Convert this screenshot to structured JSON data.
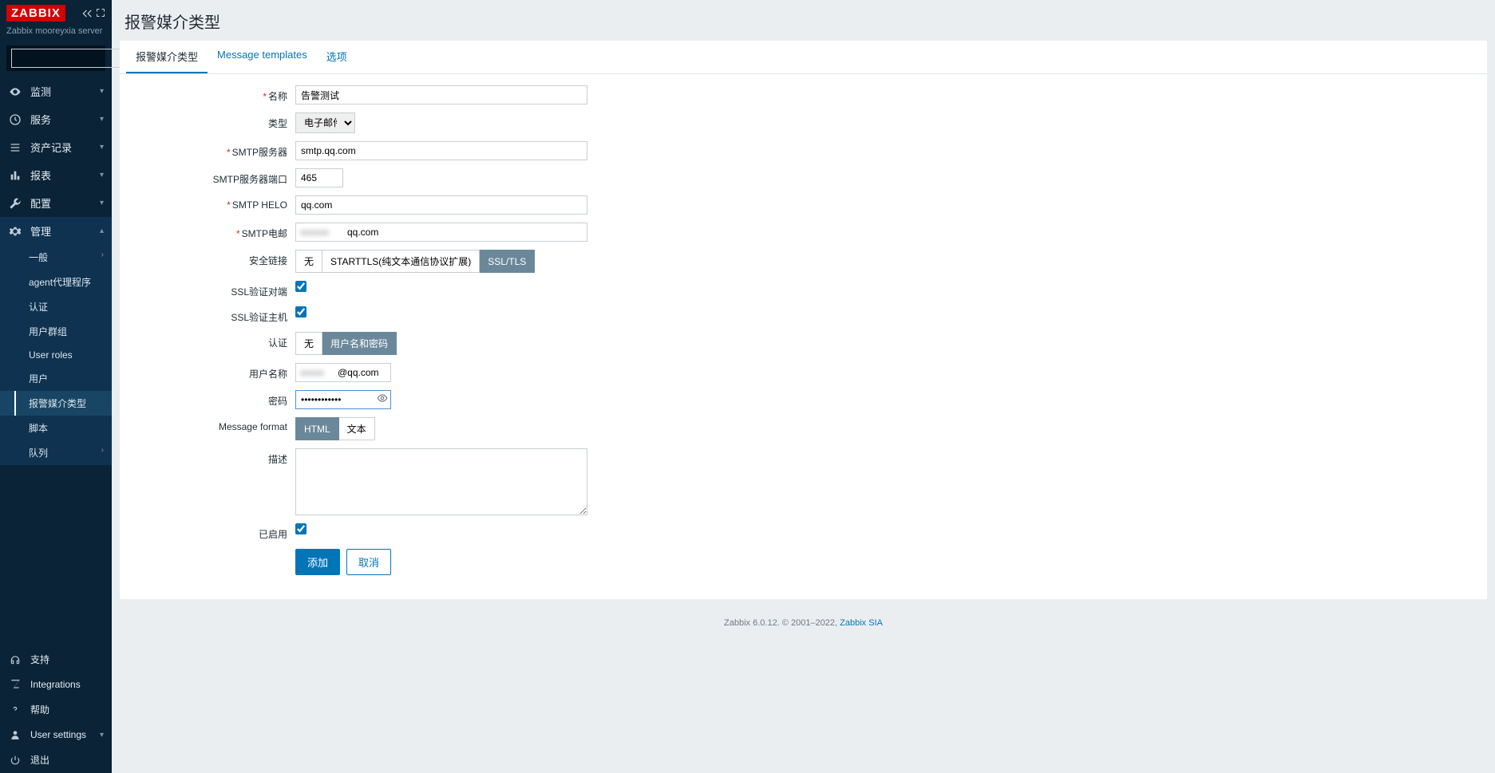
{
  "brand": "ZABBIX",
  "server_name": "Zabbix mooreyxia server",
  "search_placeholder": "",
  "nav": {
    "monitor": "监测",
    "service": "服务",
    "asset": "资产记录",
    "report": "报表",
    "config": "配置",
    "admin": "管理"
  },
  "admin_sub": {
    "general": "一般",
    "agent": "agent代理程序",
    "auth": "认证",
    "user_groups": "用户群组",
    "user_roles": "User roles",
    "users": "用户",
    "media_types": "报警媒介类型",
    "scripts": "脚本",
    "queue": "队列"
  },
  "bottom_nav": {
    "support": "支持",
    "integrations": "Integrations",
    "help": "帮助",
    "user_settings": "User settings",
    "signout": "退出"
  },
  "page": {
    "title": "报警媒介类型",
    "tabs": {
      "t1": "报警媒介类型",
      "t2": "Message templates",
      "t3": "选项"
    }
  },
  "form": {
    "labels": {
      "name": "名称",
      "type": "类型",
      "smtp_server": "SMTP服务器",
      "smtp_port": "SMTP服务器端口",
      "smtp_helo": "SMTP HELO",
      "smtp_email": "SMTP电邮",
      "security": "安全链接",
      "ssl_peer": "SSL验证对端",
      "ssl_host": "SSL验证主机",
      "auth": "认证",
      "username": "用户名称",
      "password": "密码",
      "msg_format": "Message format",
      "description": "描述",
      "enabled": "已启用"
    },
    "values": {
      "name": "告警测试",
      "type": "电子邮件",
      "smtp_server": "smtp.qq.com",
      "smtp_port": "465",
      "smtp_helo": "qq.com",
      "smtp_email_prefix": "",
      "smtp_email_suffix": "qq.com",
      "username_prefix": "",
      "username_suffix": "@qq.com",
      "password": "••••••••••••",
      "description": ""
    },
    "options": {
      "security": {
        "none": "无",
        "starttls": "STARTTLS(纯文本通信协议扩展)",
        "ssltls": "SSL/TLS"
      },
      "auth": {
        "none": "无",
        "userpass": "用户名和密码"
      },
      "msg_format": {
        "html": "HTML",
        "text": "文本"
      }
    },
    "buttons": {
      "add": "添加",
      "cancel": "取消"
    }
  },
  "footer": {
    "text": "Zabbix 6.0.12. © 2001–2022, ",
    "link": "Zabbix SIA"
  }
}
